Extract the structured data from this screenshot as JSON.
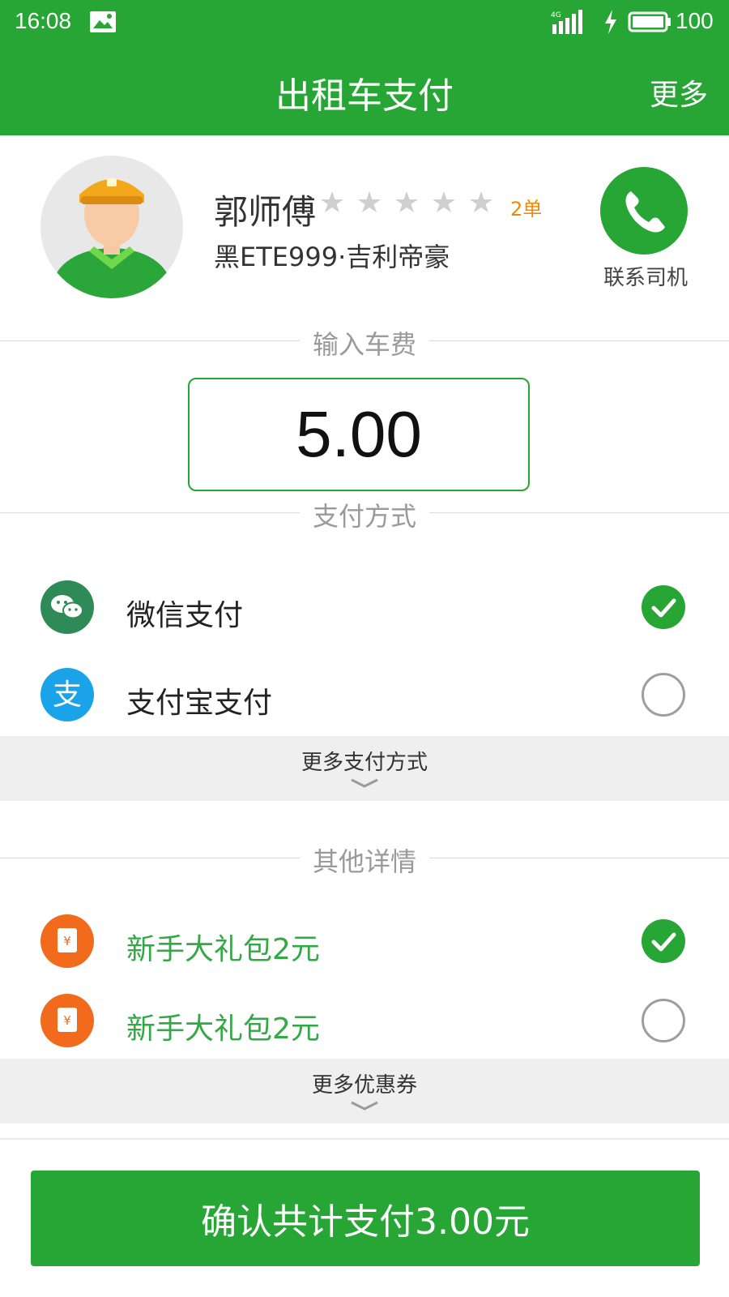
{
  "status_bar": {
    "time": "16:08",
    "network": "4G",
    "battery": "100"
  },
  "header": {
    "title": "出租车支付",
    "more_label": "更多"
  },
  "driver": {
    "name": "郭师傅",
    "rating_stars": 0,
    "max_stars": 5,
    "orders": "2单",
    "car": "黑ETE999·吉利帝豪",
    "call_label": "联系司机"
  },
  "fare": {
    "section_label": "输入车费",
    "value": "5.00"
  },
  "payment": {
    "section_label": "支付方式",
    "methods": [
      {
        "label": "微信支付",
        "icon": "wechat-icon",
        "selected": true
      },
      {
        "label": "支付宝支付",
        "icon": "alipay-icon",
        "selected": false
      }
    ],
    "more_label": "更多支付方式"
  },
  "details": {
    "section_label": "其他详情",
    "coupons": [
      {
        "label": "新手大礼包2元",
        "icon": "coupon-icon",
        "selected": true
      },
      {
        "label": "新手大礼包2元",
        "icon": "coupon-icon",
        "selected": false
      }
    ],
    "more_label": "更多优惠券"
  },
  "confirm_label": "确认共计支付3.00元",
  "colors": {
    "primary": "#27a535",
    "coupon_text": "#32a846",
    "orders": "#f08a00",
    "coupon_icon": "#f26a1b",
    "alipay": "#1aa3e8",
    "wechat": "#2e8b57"
  }
}
